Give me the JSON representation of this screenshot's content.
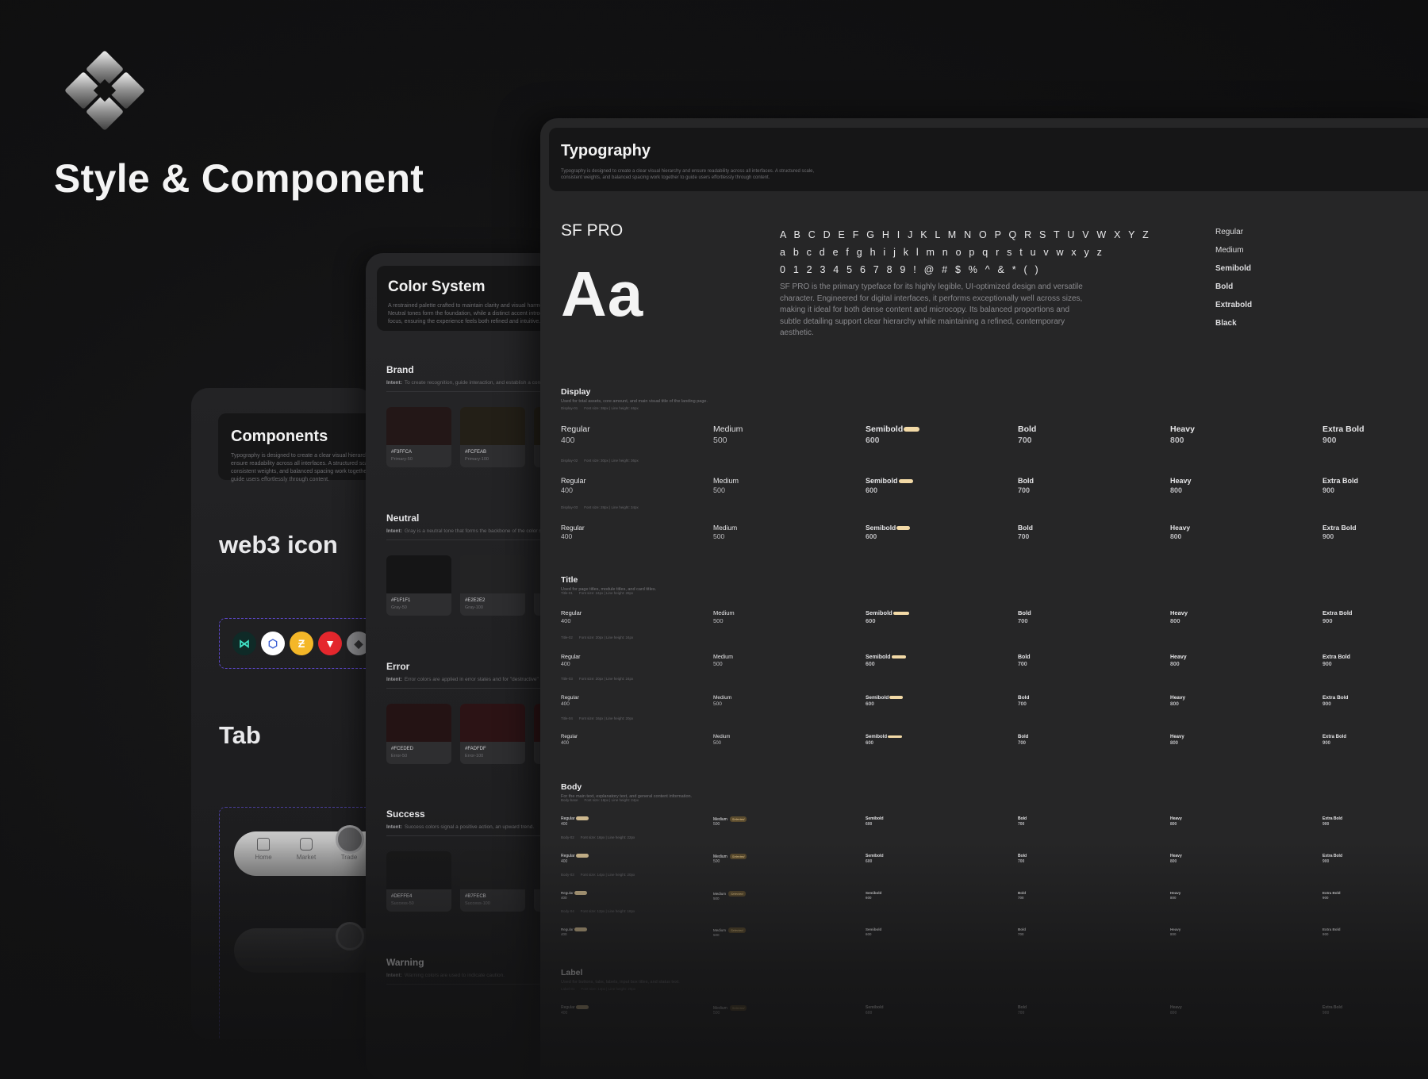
{
  "hero": {
    "title": "Style & Component"
  },
  "components": {
    "title": "Components",
    "desc": "Typography is designed to create a clear visual hierarchy and ensure readability across all interfaces. A structured scale, consistent weights, and balanced spacing work together to guide users effortlessly through content.",
    "web3_title": "web3 icon",
    "tab_title": "Tab",
    "coins": [
      {
        "name": "injective-icon",
        "bg": "#0f2a27",
        "fg": "#3fe0c4",
        "glyph": "⋈"
      },
      {
        "name": "chainlink-icon",
        "bg": "#ffffff",
        "fg": "#375bd2",
        "glyph": "⬡"
      },
      {
        "name": "zcash-icon",
        "bg": "#f4b728",
        "fg": "#ffffff",
        "glyph": "Ƶ"
      },
      {
        "name": "tron-icon",
        "bg": "#e5272d",
        "fg": "#ffffff",
        "glyph": "▼"
      },
      {
        "name": "ethereum-icon",
        "bg": "#8c8c8f",
        "fg": "#2f2f31",
        "glyph": "◆"
      }
    ],
    "tabs": [
      {
        "label": "Home",
        "icon": "home-icon"
      },
      {
        "label": "Market",
        "icon": "chart-icon"
      },
      {
        "label": "Trade",
        "icon": "trade-icon"
      }
    ]
  },
  "color_system": {
    "title": "Color System",
    "desc": "A restrained palette crafted to maintain clarity and visual harmony. Neutral tones form the foundation, while a distinct accent introduces focus, ensuring the experience feels both refined and intuitive.",
    "groups": [
      {
        "name": "Brand",
        "intent_label": "Intent:",
        "intent": "To create recognition, guide interaction, and establish a consistent identity.",
        "swatches": [
          {
            "hex": "#F3FFCA",
            "token": "Primary-50",
            "color": "#231717"
          },
          {
            "hex": "#FCFEAB",
            "token": "Primary-100",
            "color": "#231f17"
          }
        ]
      },
      {
        "name": "Neutral",
        "intent_label": "Intent:",
        "intent": "Gray is a neutral tone that forms the backbone of the color system.",
        "swatches": [
          {
            "hex": "#F1F1F1",
            "token": "Gray-50",
            "color": "#151516"
          },
          {
            "hex": "#E2E2E2",
            "token": "Gray-100",
            "color": "#232324"
          }
        ]
      },
      {
        "name": "Error",
        "intent_label": "Intent:",
        "intent": "Error colors are applied in error states and for \"destructive\" actions.",
        "swatches": [
          {
            "hex": "#FCEDED",
            "token": "Error-50",
            "color": "#241314"
          },
          {
            "hex": "#FADFDF",
            "token": "Error-100",
            "color": "#2c1315"
          }
        ]
      },
      {
        "name": "Success",
        "intent_label": "Intent:",
        "intent": "Success colors signal a positive action, an upward trend.",
        "swatches": [
          {
            "hex": "#DEFFE4",
            "token": "Success-50",
            "color": "#181819"
          },
          {
            "hex": "#B7FECB",
            "token": "Success-100",
            "color": "#1e1e1f"
          }
        ]
      },
      {
        "name": "Warning",
        "intent_label": "Intent:",
        "intent": "Warning colors are used to indicate caution.",
        "swatches": []
      }
    ]
  },
  "typography": {
    "title": "Typography",
    "desc": "Typography is designed to create a clear visual hierarchy and ensure readability across all interfaces. A structured scale, consistent weights, and balanced spacing work together to guide users effortlessly through content.",
    "font_name": "SF PRO",
    "sample": "Aa",
    "upper": "A B C D E F G H I J K L M N O P Q R S T U V W X Y Z",
    "lower": "a b c d e f g h i j k l m n o p q r s t u v w x y z",
    "digits": "0 1 2 3 4 5 6 7 8 9  ! @ # $ % ^ & * ( )",
    "about": "SF PRO is the primary typeface for its highly legible, UI-optimized design and versatile character. Engineered for digital interfaces, it performs exceptionally well across sizes, making it ideal for both dense content and microcopy. Its balanced proportions and subtle detailing support clear hierarchy while maintaining a refined, contemporary aesthetic.",
    "weights_list": [
      "Regular",
      "Medium",
      "Semibold",
      "Bold",
      "Extrabold",
      "Black"
    ],
    "sections": [
      {
        "name": "Display",
        "sub": "Used for total assets, core amount, and main visual title of the landing page.",
        "rows": [
          {
            "label": "Display-01",
            "spec": "Font size: 38px | Line height: 46px"
          },
          {
            "label": "Display-02",
            "spec": "Font size: 30px | Line height: 36px"
          },
          {
            "label": "Display-03",
            "spec": "Font size: 28px | Line height: 34px"
          }
        ]
      },
      {
        "name": "Title",
        "sub": "Used for page titles, module titles, and card titles.",
        "rows": [
          {
            "label": "Title-01",
            "spec": "Font size: 24px | Line height: 28px"
          },
          {
            "label": "Title-02",
            "spec": "Font size: 20px | Line height: 24px"
          },
          {
            "label": "Title-03",
            "spec": "Font size: 20px | Line height: 24px"
          },
          {
            "label": "Title-04",
            "spec": "Font size: 16px | Line height: 20px"
          }
        ]
      },
      {
        "name": "Body",
        "sub": "For the main text, explanatory text, and general content information.",
        "rows": [
          {
            "label": "Body-base",
            "spec": "Font size: 18px | Line height: 24px"
          },
          {
            "label": "Body-02",
            "spec": "Font size: 16px | Line height: 22px"
          },
          {
            "label": "Body-03",
            "spec": "Font size: 14px | Line height: 20px"
          },
          {
            "label": "Body-04",
            "spec": "Font size: 12px | Line height: 18px"
          }
        ]
      },
      {
        "name": "Label",
        "sub": "Used for buttons, tabs, labels, input box titles, and status text.",
        "rows": [
          {
            "label": "Label-01",
            "spec": "Font size: 14px | Line height: 20px"
          }
        ]
      }
    ],
    "weights": [
      {
        "name": "Regular",
        "num": "400"
      },
      {
        "name": "Medium",
        "num": "500"
      },
      {
        "name": "Semibold",
        "num": "600"
      },
      {
        "name": "Bold",
        "num": "700"
      },
      {
        "name": "Heavy",
        "num": "800"
      },
      {
        "name": "Extra Bold",
        "num": "900"
      }
    ],
    "badge": "Selected"
  }
}
